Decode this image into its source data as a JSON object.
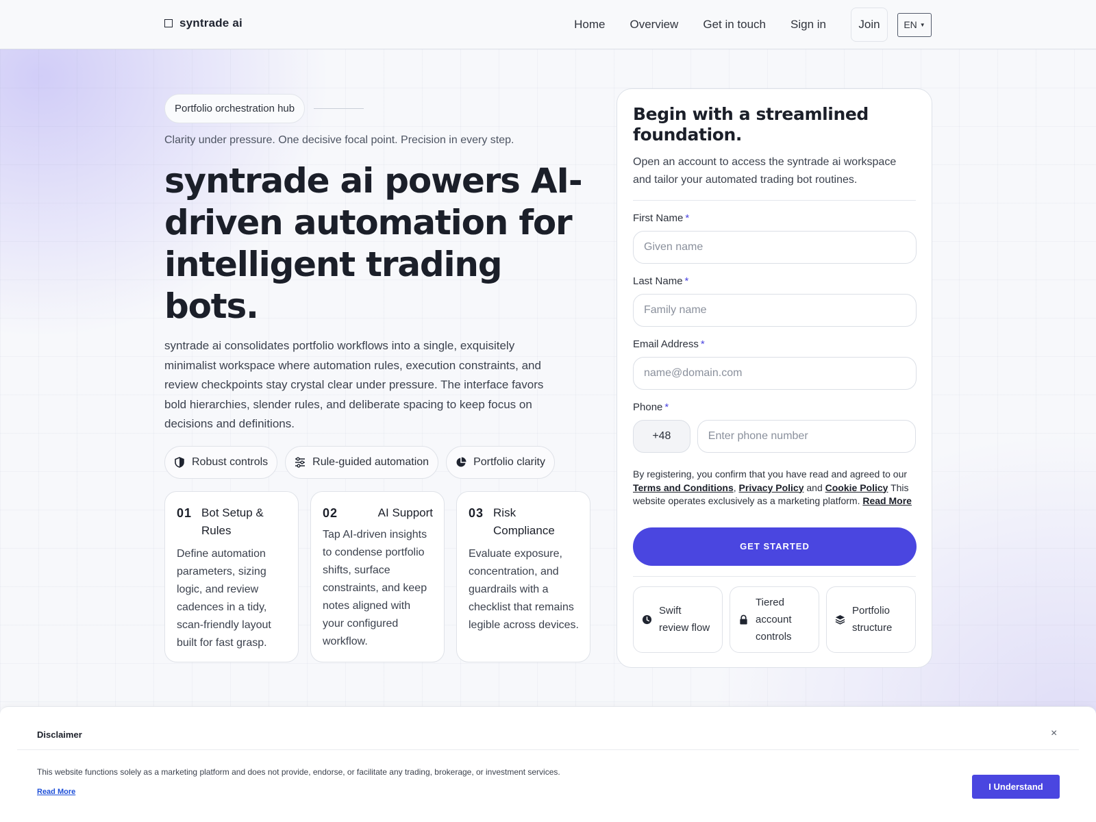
{
  "brand": {
    "name": "syntrade ai"
  },
  "nav": {
    "links": [
      "Home",
      "Overview",
      "Get in touch",
      "Sign in"
    ],
    "join": "Join",
    "language": "EN"
  },
  "hero": {
    "pill": "Portfolio orchestration hub",
    "tagline": "Clarity under pressure. One decisive focal point. Precision in every step.",
    "headline": "syntrade ai powers AI-driven automation for intelligent trading bots.",
    "lede": "syntrade ai consolidates portfolio workflows into a single, exquisitely minimalist workspace where automation rules, execution constraints, and review checkpoints stay crystal clear under pressure. The interface favors bold hierarchies, slender rules, and deliberate spacing to keep focus on decisions and definitions.",
    "chips": [
      {
        "label": "Robust controls",
        "icon": "shield-icon"
      },
      {
        "label": "Rule-guided automation",
        "icon": "sliders-icon"
      },
      {
        "label": "Portfolio clarity",
        "icon": "pie-chart-icon"
      }
    ],
    "cards": [
      {
        "num": "01",
        "title": "Bot Setup & Rules",
        "text": "Define automation parameters, sizing logic, and review cadences in a tidy, scan-friendly layout built for fast grasp."
      },
      {
        "num": "02",
        "title": "AI Support",
        "text": "Tap AI-driven insights to condense portfolio shifts, surface constraints, and keep notes aligned with your configured workflow."
      },
      {
        "num": "03",
        "title": "Risk Compliance",
        "text": "Evaluate exposure, concentration, and guardrails with a checklist that remains legible across devices."
      }
    ]
  },
  "form": {
    "title": "Begin with a streamlined foundation.",
    "subtitle": "Open an account to access the syntrade ai workspace and tailor your automated trading bot routines.",
    "first_name": {
      "label": "First Name",
      "placeholder": "Given name"
    },
    "last_name": {
      "label": "Last Name",
      "placeholder": "Family name"
    },
    "email": {
      "label": "Email Address",
      "placeholder": "name@domain.com"
    },
    "phone": {
      "label": "Phone",
      "code": "+48",
      "placeholder": "Enter phone number"
    },
    "required_mark": "*",
    "legal": {
      "prefix": "By registering, you confirm that you have read and agreed to our ",
      "terms": "Terms and Conditions",
      "comma": ", ",
      "privacy": "Privacy Policy",
      "and": " and ",
      "cookie": "Cookie Policy",
      "suffix": " This website operates exclusively as a marketing platform. ",
      "read_more": "Read More"
    },
    "cta": "GET STARTED",
    "features": [
      {
        "label": "Swift review flow",
        "icon": "clock-icon"
      },
      {
        "label": "Tiered account controls",
        "icon": "lock-icon"
      },
      {
        "label": "Portfolio structure",
        "icon": "layers-icon"
      }
    ]
  },
  "disclaimer": {
    "title": "Disclaimer",
    "close": "×",
    "text": "This website functions solely as a marketing platform and does not provide, endorse, or facilitate any trading, brokerage, or investment services.",
    "read_more": "Read More",
    "button": "I Understand"
  },
  "colors": {
    "accent": "#4a46e0",
    "text": "#1b1f29"
  }
}
